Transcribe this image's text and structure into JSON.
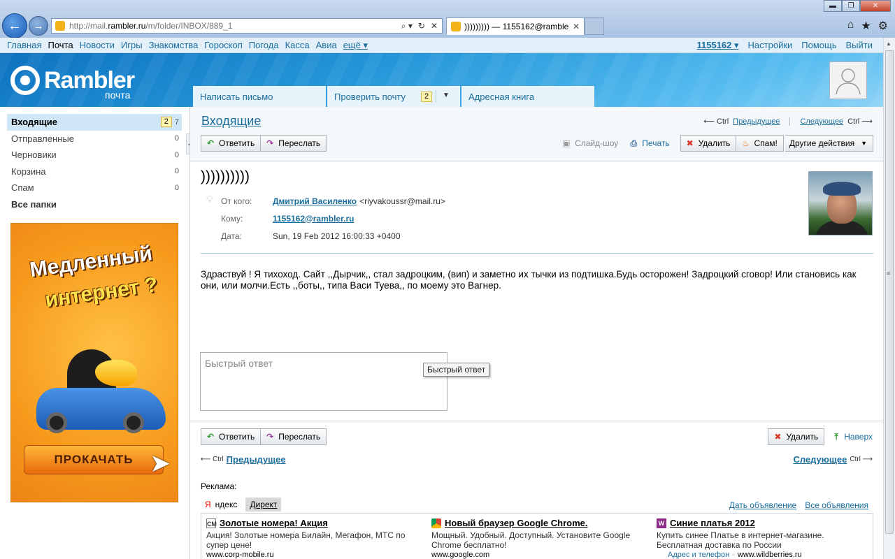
{
  "browser": {
    "url_prefix": "http://mail.",
    "url_domain": "rambler.ru",
    "url_path": "/m/folder/INBOX/889_1",
    "tab_title": "))))))))) — 1155162@rambler...",
    "search_glyph": "⌕ ▾",
    "refresh_glyph": "↻",
    "stop_glyph": "✕",
    "back_glyph": "←",
    "forward_glyph": "→"
  },
  "topnav": {
    "items": [
      "Главная",
      "Почта",
      "Новости",
      "Игры",
      "Знакомства",
      "Гороскоп",
      "Погода",
      "Касса",
      "Авиа"
    ],
    "more": "ещё ▾",
    "user": "1155162 ▾",
    "settings": "Настройки",
    "help": "Помощь",
    "logout": "Выйти"
  },
  "header": {
    "logo_word": "Rambler",
    "logo_sub": "почта",
    "tabs": {
      "compose": "Написать письмо",
      "check": "Проверить почту",
      "check_count": "2",
      "address_book": "Адресная книга"
    }
  },
  "sidebar": {
    "inbox": {
      "label": "Входящие",
      "unread": "2",
      "total": "7"
    },
    "sent": {
      "label": "Отправленные",
      "count": "0"
    },
    "drafts": {
      "label": "Черновики",
      "count": "0"
    },
    "trash": {
      "label": "Корзина",
      "count": "0"
    },
    "spam": {
      "label": "Спам",
      "count": "0"
    },
    "all": "Все папки"
  },
  "ad_banner": {
    "line1": "Медленный",
    "line2": "интернет ?",
    "button": "ПРОКАЧАТЬ"
  },
  "message": {
    "folder_title": "Входящие",
    "prev_ctrl": "⟵ Ctrl",
    "prev": "Предыдущее",
    "next": "Следующее",
    "next_ctrl": "Ctrl ⟶",
    "reply": "Ответить",
    "forward": "Переслать",
    "slideshow": "Слайд-шоу",
    "print": "Печать",
    "delete": "Удалить",
    "spam": "Спам!",
    "other_actions": "Другие действия",
    "subject": "))))))))))",
    "from_label": "От кого:",
    "from_name": "Дмитрий Василенко",
    "from_email": "<riyvakoussr@mail.ru>",
    "to_label": "Кому:",
    "to": "1155162@rambler.ru",
    "date_label": "Дата:",
    "date": "Sun, 19 Feb 2012 16:00:33 +0400",
    "body": "Здраствуй ! Я тихоход. Сайт ,,Дырчик,, стал задроцким, (вип) и заметно их тычки из подтишка.Будь осторожен! Задроцкий сговор! Или становись как они, или молчи.Есть ,,боты,, типа Васи Туева,, по моему это Вагнер.",
    "quick_placeholder": "Быстрый ответ",
    "quick_tooltip": "Быстрый ответ",
    "to_top": "Наверх",
    "bottom_prev_ctrl": "⟵ Ctrl",
    "bottom_next_ctrl": "Ctrl ⟶"
  },
  "ads": {
    "label": "Реклама:",
    "tab_yandex_first": "Я",
    "tab_yandex_rest": "ндекс",
    "tab_direct": "Директ",
    "place_ad": "Дать объявление",
    "all_ads": "Все объявления",
    "items": [
      {
        "icon": "СМ",
        "title": "Золотые номера! Акция",
        "desc": "Акция! Золотые номера Билайн, Мегафон, МТС по супер цене!",
        "url": "www.corp-mobile.ru",
        "extra": ""
      },
      {
        "icon": "",
        "title": "Новый браузер Google Chrome.",
        "desc": "Мощный. Удобный. Доступный. Установите Google Chrome бесплатно!",
        "url": "www.google.com",
        "extra": ""
      },
      {
        "icon": "W",
        "title": "Синие платья 2012",
        "desc": "Купить синее Платье в интернет-магазине. Бесплатная доставка по России",
        "url": "www.wildberries.ru",
        "extra": "Адрес и телефон ·"
      }
    ]
  }
}
